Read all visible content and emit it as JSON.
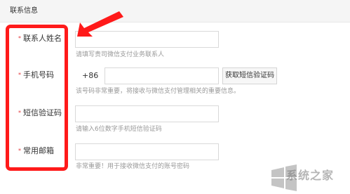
{
  "section": {
    "title": "联系信息"
  },
  "fields": {
    "contact_name": {
      "label": "联系人姓名",
      "value": "",
      "hint": "请填写贵司微信支付业务联系人"
    },
    "phone": {
      "label": "手机号码",
      "prefix": "+86",
      "value": "",
      "button_label": "获取短信验证码",
      "hint": "该号码非常重要，将接收与微信支付管理相关的重要信息。"
    },
    "sms_code": {
      "label": "短信验证码",
      "value": "",
      "hint": "请输入6位数字手机短信验证码"
    },
    "email": {
      "label": "常用邮箱",
      "value": "",
      "hint": "非常重要！用于接收微信支付的账号密码"
    }
  },
  "required_marker": "*",
  "annotation": {
    "color": "#ff1a1a"
  },
  "watermark": {
    "text": "系统之家",
    "icon": "windows-logo-icon"
  }
}
